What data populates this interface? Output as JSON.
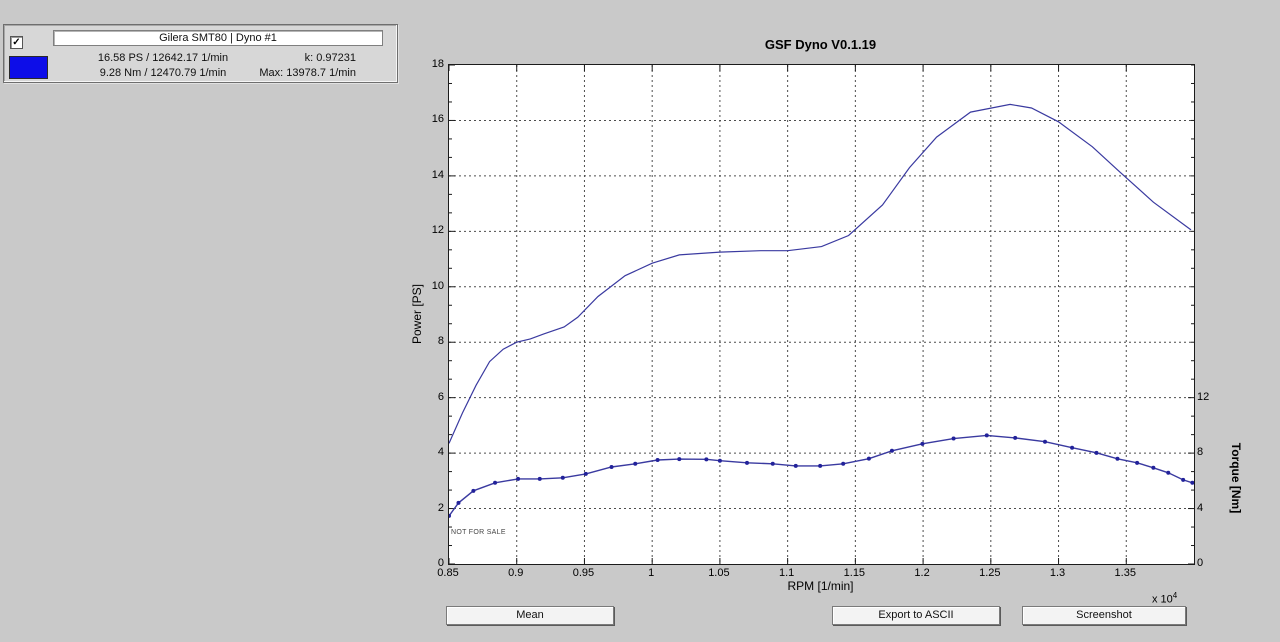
{
  "icons": {
    "check": "✓"
  },
  "info_panel": {
    "checkbox_checked": true,
    "name_field": "Gilera SMT80 | Dyno #1",
    "swatch_color": "#0d0de8",
    "stats": {
      "power_peak": "16.58 PS / 12642.17 1/min",
      "k": "k: 0.97231",
      "torque_peak": "9.28 Nm / 12470.79 1/min",
      "max_rpm": "Max: 13978.7 1/min"
    }
  },
  "buttons": [
    {
      "label": "Mean"
    },
    {
      "label": "Export to ASCII"
    },
    {
      "label": "Screenshot"
    }
  ],
  "chart_data": {
    "type": "line",
    "title": "GSF Dyno V0.1.19",
    "xlabel": "RPM [1/min]",
    "x_multiplier_base": "x 10",
    "x_multiplier_exp": "4",
    "ylabel_left": "Power [PS]",
    "ylabel_right": "Torque [Nm]",
    "watermark": "NOT FOR SALE",
    "grid": true,
    "legend_position": "none",
    "xlim": [
      8500,
      14000
    ],
    "ylim_left": [
      0,
      18
    ],
    "ylim_right": [
      0,
      36
    ],
    "line_color": "#3a3aa0",
    "marker_color": "#22229a",
    "grid_color": "#4d4d4d",
    "xticks": {
      "values": [
        8500,
        9000,
        9500,
        10000,
        10500,
        11000,
        11500,
        12000,
        12500,
        13000,
        13500
      ],
      "labels": [
        "0.85",
        "0.9",
        "0.95",
        "1",
        "1.05",
        "1.1",
        "1.15",
        "1.2",
        "1.25",
        "1.3",
        "1.35"
      ]
    },
    "yticks_left": {
      "values": [
        0,
        2,
        4,
        6,
        8,
        10,
        12,
        14,
        16,
        18
      ],
      "labels": [
        "0",
        "2",
        "4",
        "6",
        "8",
        "10",
        "12",
        "14",
        "16",
        "18"
      ]
    },
    "yticks_right": {
      "values": [
        0,
        4,
        8,
        12
      ],
      "labels": [
        "0",
        "4",
        "8",
        "12"
      ]
    },
    "series": [
      {
        "name": "Power",
        "axis": "left",
        "unit": "PS",
        "marker": "none",
        "points": [
          [
            8500,
            4.35
          ],
          [
            8600,
            5.45
          ],
          [
            8700,
            6.45
          ],
          [
            8800,
            7.3
          ],
          [
            8900,
            7.75
          ],
          [
            9000,
            8.0
          ],
          [
            9100,
            8.12
          ],
          [
            9200,
            8.3
          ],
          [
            9350,
            8.55
          ],
          [
            9450,
            8.9
          ],
          [
            9600,
            9.65
          ],
          [
            9800,
            10.4
          ],
          [
            10000,
            10.85
          ],
          [
            10200,
            11.15
          ],
          [
            10500,
            11.25
          ],
          [
            10800,
            11.3
          ],
          [
            11000,
            11.3
          ],
          [
            11250,
            11.45
          ],
          [
            11450,
            11.85
          ],
          [
            11700,
            12.95
          ],
          [
            11900,
            14.3
          ],
          [
            12100,
            15.4
          ],
          [
            12350,
            16.3
          ],
          [
            12642,
            16.58
          ],
          [
            12800,
            16.45
          ],
          [
            13000,
            15.95
          ],
          [
            13250,
            15.05
          ],
          [
            13450,
            14.15
          ],
          [
            13700,
            13.05
          ],
          [
            13978,
            12.05
          ]
        ]
      },
      {
        "name": "Torque",
        "axis": "right",
        "unit": "Nm",
        "marker": "dot",
        "points": [
          [
            8500,
            3.47
          ],
          [
            8570,
            4.41
          ],
          [
            8680,
            5.28
          ],
          [
            8840,
            5.86
          ],
          [
            9010,
            6.14
          ],
          [
            9170,
            6.14
          ],
          [
            9340,
            6.22
          ],
          [
            9510,
            6.5
          ],
          [
            9700,
            7.0
          ],
          [
            9875,
            7.23
          ],
          [
            10040,
            7.5
          ],
          [
            10200,
            7.57
          ],
          [
            10400,
            7.55
          ],
          [
            10500,
            7.45
          ],
          [
            10700,
            7.3
          ],
          [
            10890,
            7.23
          ],
          [
            11060,
            7.08
          ],
          [
            11240,
            7.08
          ],
          [
            11410,
            7.23
          ],
          [
            11600,
            7.6
          ],
          [
            11770,
            8.17
          ],
          [
            11995,
            8.67
          ],
          [
            12225,
            9.05
          ],
          [
            12470,
            9.28
          ],
          [
            12680,
            9.1
          ],
          [
            12900,
            8.82
          ],
          [
            13100,
            8.39
          ],
          [
            13280,
            8.02
          ],
          [
            13435,
            7.59
          ],
          [
            13580,
            7.3
          ],
          [
            13700,
            6.94
          ],
          [
            13810,
            6.58
          ],
          [
            13920,
            6.07
          ],
          [
            13988,
            5.86
          ]
        ]
      }
    ]
  }
}
